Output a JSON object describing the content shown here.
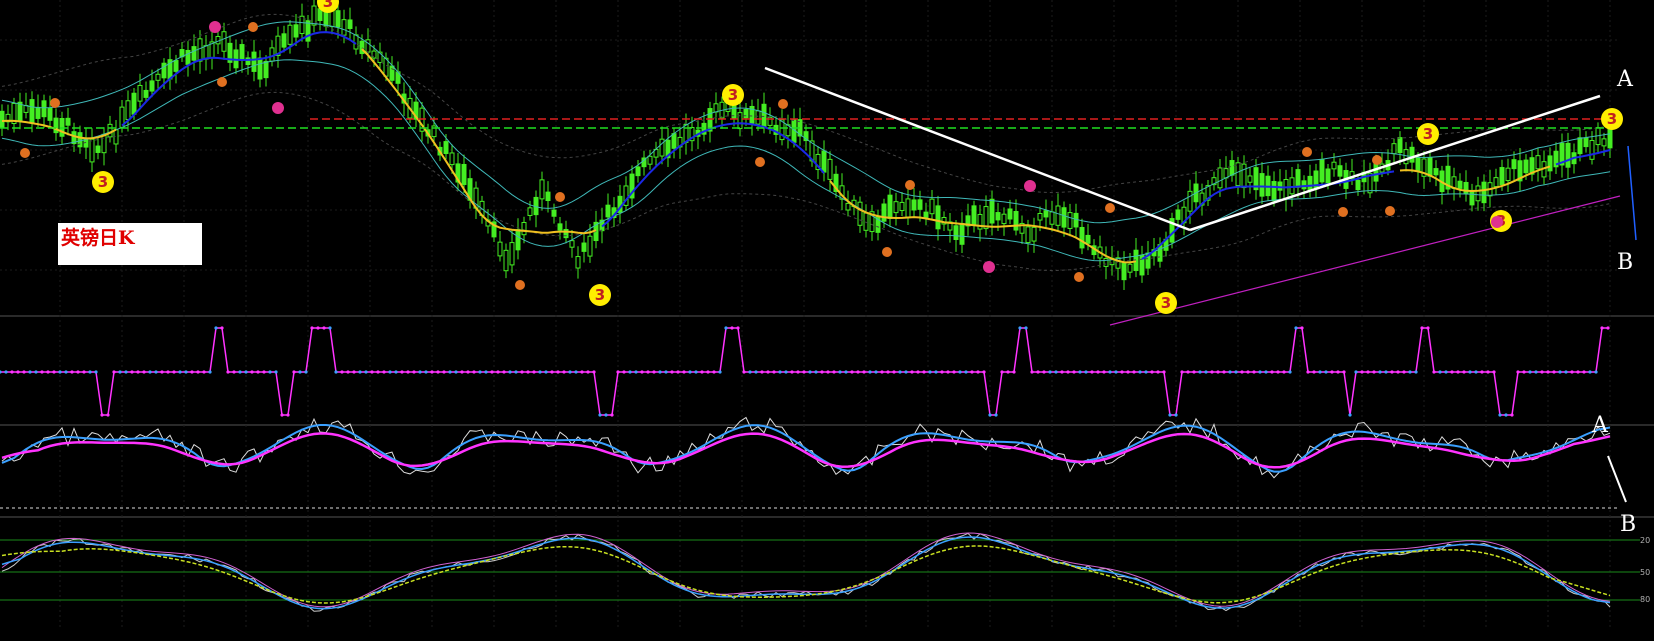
{
  "title_label": "英镑日K",
  "side_labels": {
    "main_top": "A",
    "main_bottom": "B",
    "osc_top": "A",
    "osc_bottom": "B"
  },
  "subpanel_headers": {
    "panel2": "",
    "panel3": "",
    "panel4": ""
  },
  "right_axis_labels": {
    "panel4_top": "20",
    "panel4_mid": "50",
    "panel4_bottom": "80"
  },
  "date_ticks": [
    "",
    "",
    "",
    "",
    "",
    "",
    "",
    "",
    "",
    "",
    "",
    "",
    "",
    "",
    "",
    "",
    "",
    "",
    "",
    "",
    "",
    "",
    "",
    "",
    "",
    "",
    ""
  ],
  "colors": {
    "background": "#000000",
    "bull_candle": "#44ee22",
    "ma_blue": "#1a28e6",
    "ma_gold": "#f0c020",
    "band_cyan": "#3fb8b8",
    "level_red": "#e02020",
    "level_green": "#20e020",
    "trend_white": "#ffffff",
    "trend_magenta": "#c020c0",
    "step_magenta": "#ff33ff",
    "step_blue": "#3aa0ff",
    "marker_yellow": "#ffee00",
    "marker_orange": "#e07020",
    "marker_pink": "#e03090"
  },
  "chart_data": [
    {
      "type": "candlestick",
      "title": "英镑日K",
      "markers_count_label": "3",
      "has_grid": true,
      "trendline_labels": [
        "A",
        "B"
      ]
    },
    {
      "type": "line",
      "title": "",
      "style": "step"
    },
    {
      "type": "line",
      "title": "",
      "series_colors": [
        "#ffffff",
        "#3aa0ff",
        "#ff33ff"
      ]
    },
    {
      "type": "line",
      "title": "",
      "reference_levels": [
        20,
        50,
        80
      ]
    }
  ]
}
